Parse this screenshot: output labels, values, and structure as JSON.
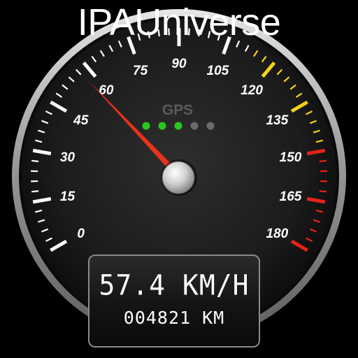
{
  "app": {
    "title": "IPAUniverse"
  },
  "gauge": {
    "scale_min": 0,
    "scale_max": 180,
    "major_tick_step": 15,
    "tick_labels": [
      "0",
      "15",
      "30",
      "45",
      "60",
      "75",
      "90",
      "105",
      "120",
      "135",
      "150",
      "165",
      "180"
    ],
    "needle_value": 57.4,
    "zones": {
      "normal_color": "#ffffff",
      "warning_color": "#f5d31a",
      "danger_color": "#e8221c"
    },
    "needle_color": "#e8321c"
  },
  "gps": {
    "label": "GPS",
    "signal_total": 5,
    "signal_active": 3,
    "active_color": "#28c81e",
    "inactive_color": "#6a6a6a"
  },
  "readout": {
    "speed": "57.4 KM/H",
    "odometer": "004821 KM"
  }
}
